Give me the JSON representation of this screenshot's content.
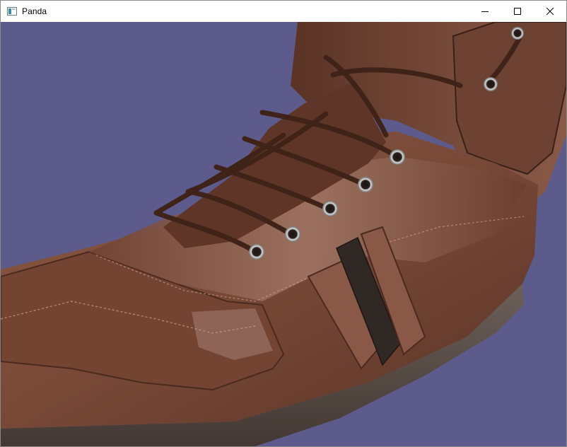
{
  "window": {
    "title": "Panda",
    "icon": "panda-window-icon",
    "controls": {
      "minimize_icon": "minimize-icon",
      "maximize_icon": "maximize-icon",
      "close_icon": "close-icon"
    }
  },
  "viewport": {
    "background_color": "#5c5b8b",
    "scene_object": "leather-sneaker-3d-model",
    "leather_color": "#7a4a38",
    "lace_color": "#3f2318",
    "stripe_color": "#2f2824",
    "sole_color": "#5e524c"
  }
}
